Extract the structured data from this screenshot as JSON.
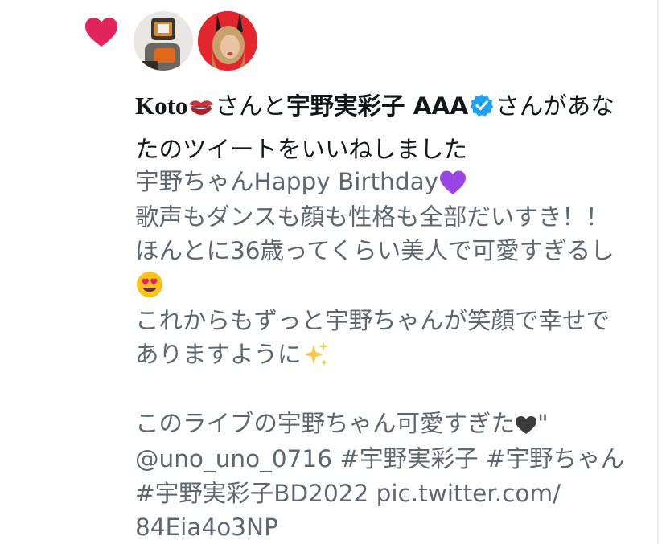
{
  "notification": {
    "user1_name": "Koto",
    "user1_emoji": "kiss-mark-icon",
    "connector": "さんと",
    "user2_name": "宇野実彩子 AAA",
    "verified": "verified-badge-icon",
    "suffix_line1": "さんがあな",
    "suffix_line2": "たのツイートをいいねしました"
  },
  "tweet": {
    "line1": "宇野ちゃんHappy Birthday",
    "line1_emoji": "purple-heart-icon",
    "line2": "歌声もダンスも顔も性格も全部だいすき！！",
    "line3": "ほんとに36歳ってくらい美人で可愛すぎるし",
    "line4_emoji": "heart-eyes-face-icon",
    "line5": "これからもずっと宇野ちゃんが笑顔で幸せで",
    "line6": "ありますように",
    "line6_emoji": "sparkles-icon",
    "line7": "このライブの宇野ちゃん可愛すぎた",
    "line7_emoji": "black-heart-icon",
    "line7_tail": "\"",
    "line8": "@uno_uno_0716 #宇野実彩子 #宇野ちゃん",
    "line9": "#宇野実彩子BD2022 pic.twitter.com/",
    "line10": "84Eia4o3NP"
  },
  "colors": {
    "like_heart": "#e0245e",
    "verified_blue": "#1da1f2",
    "primary_text": "#14171a",
    "secondary_text": "#5c6770"
  }
}
